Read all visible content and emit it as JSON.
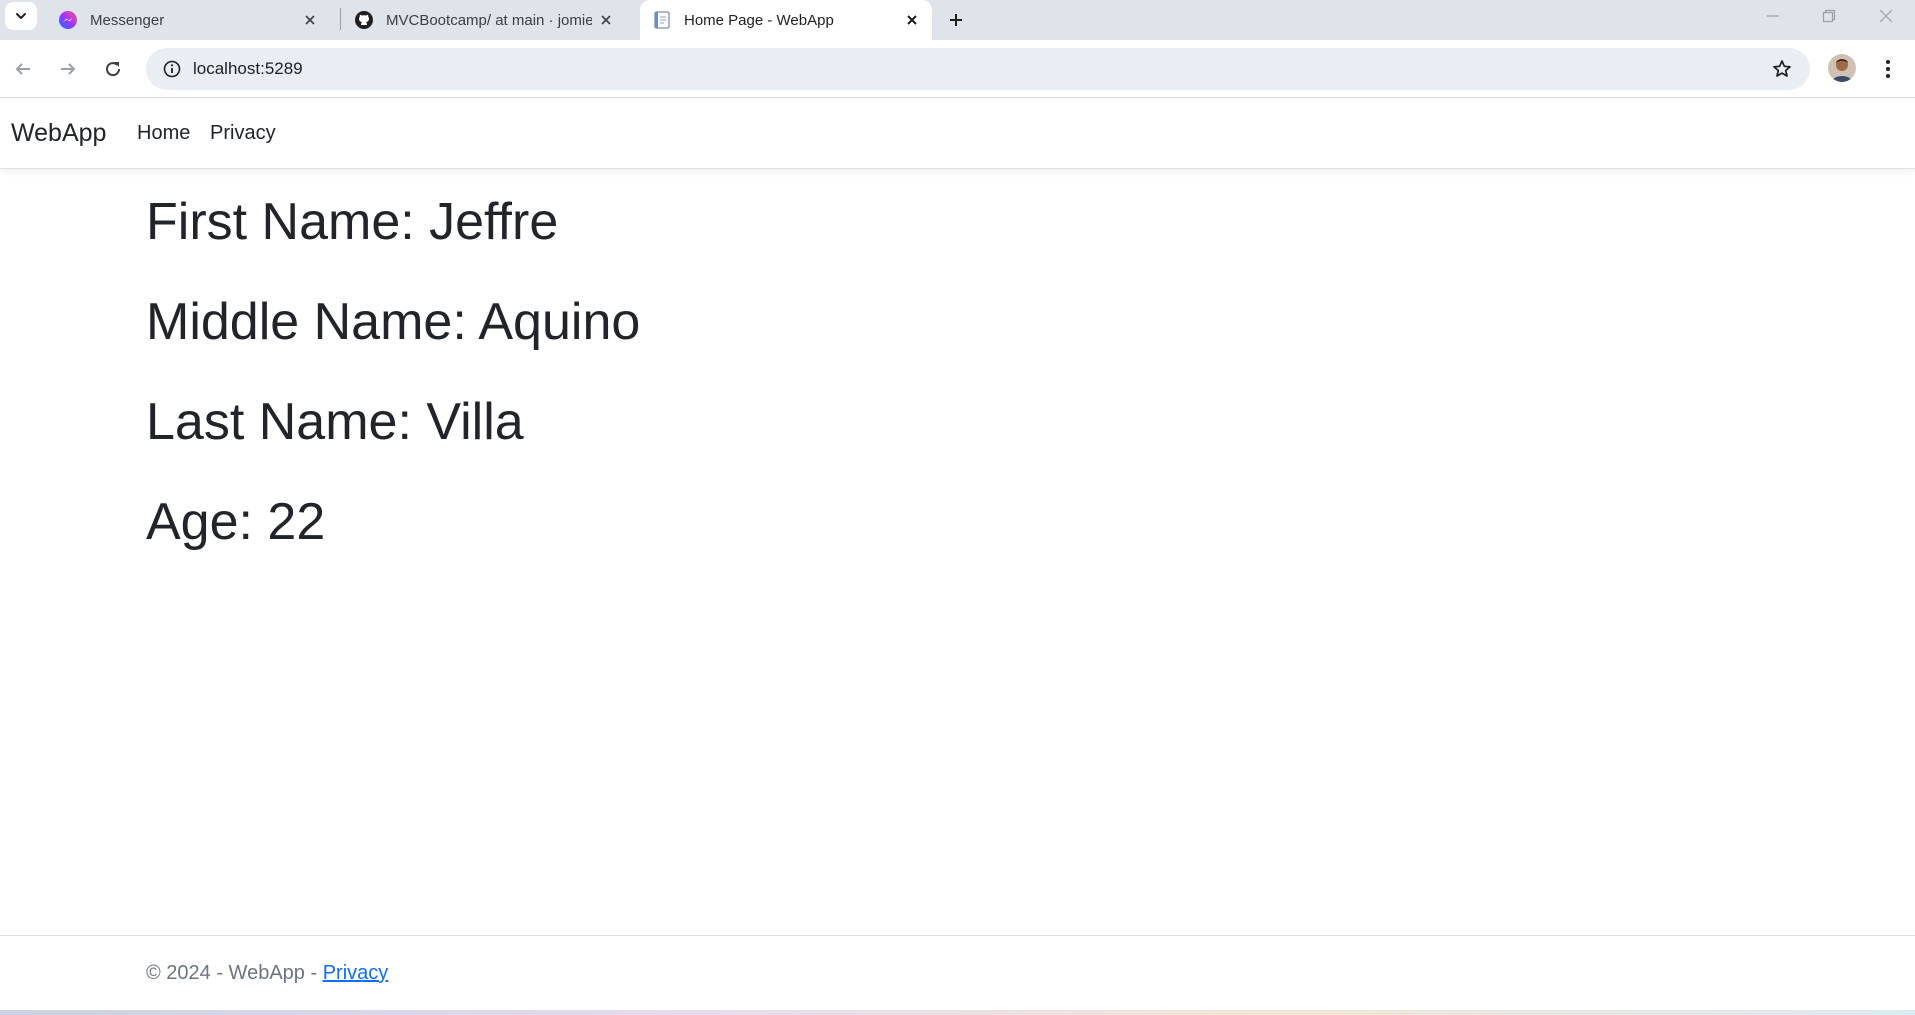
{
  "browser": {
    "tabs": [
      {
        "title": "Messenger",
        "icon": "messenger-icon",
        "active": false
      },
      {
        "title": "MVCBootcamp/ at main · jomie",
        "icon": "github-icon",
        "active": false
      },
      {
        "title": "Home Page - WebApp",
        "icon": "page-icon",
        "active": true
      }
    ],
    "address": "localhost:5289"
  },
  "site": {
    "brand": "WebApp",
    "nav": {
      "home": "Home",
      "privacy": "Privacy"
    }
  },
  "person": {
    "first_name": "First Name: Jeffre",
    "middle_name": "Middle Name: Aquino",
    "last_name": "Last Name: Villa",
    "age": "Age: 22"
  },
  "footer": {
    "text": "© 2024 - WebApp - ",
    "link": "Privacy"
  },
  "colors": {
    "accent_link": "#0d6efd",
    "text": "#212529",
    "muted": "#6c757d"
  }
}
